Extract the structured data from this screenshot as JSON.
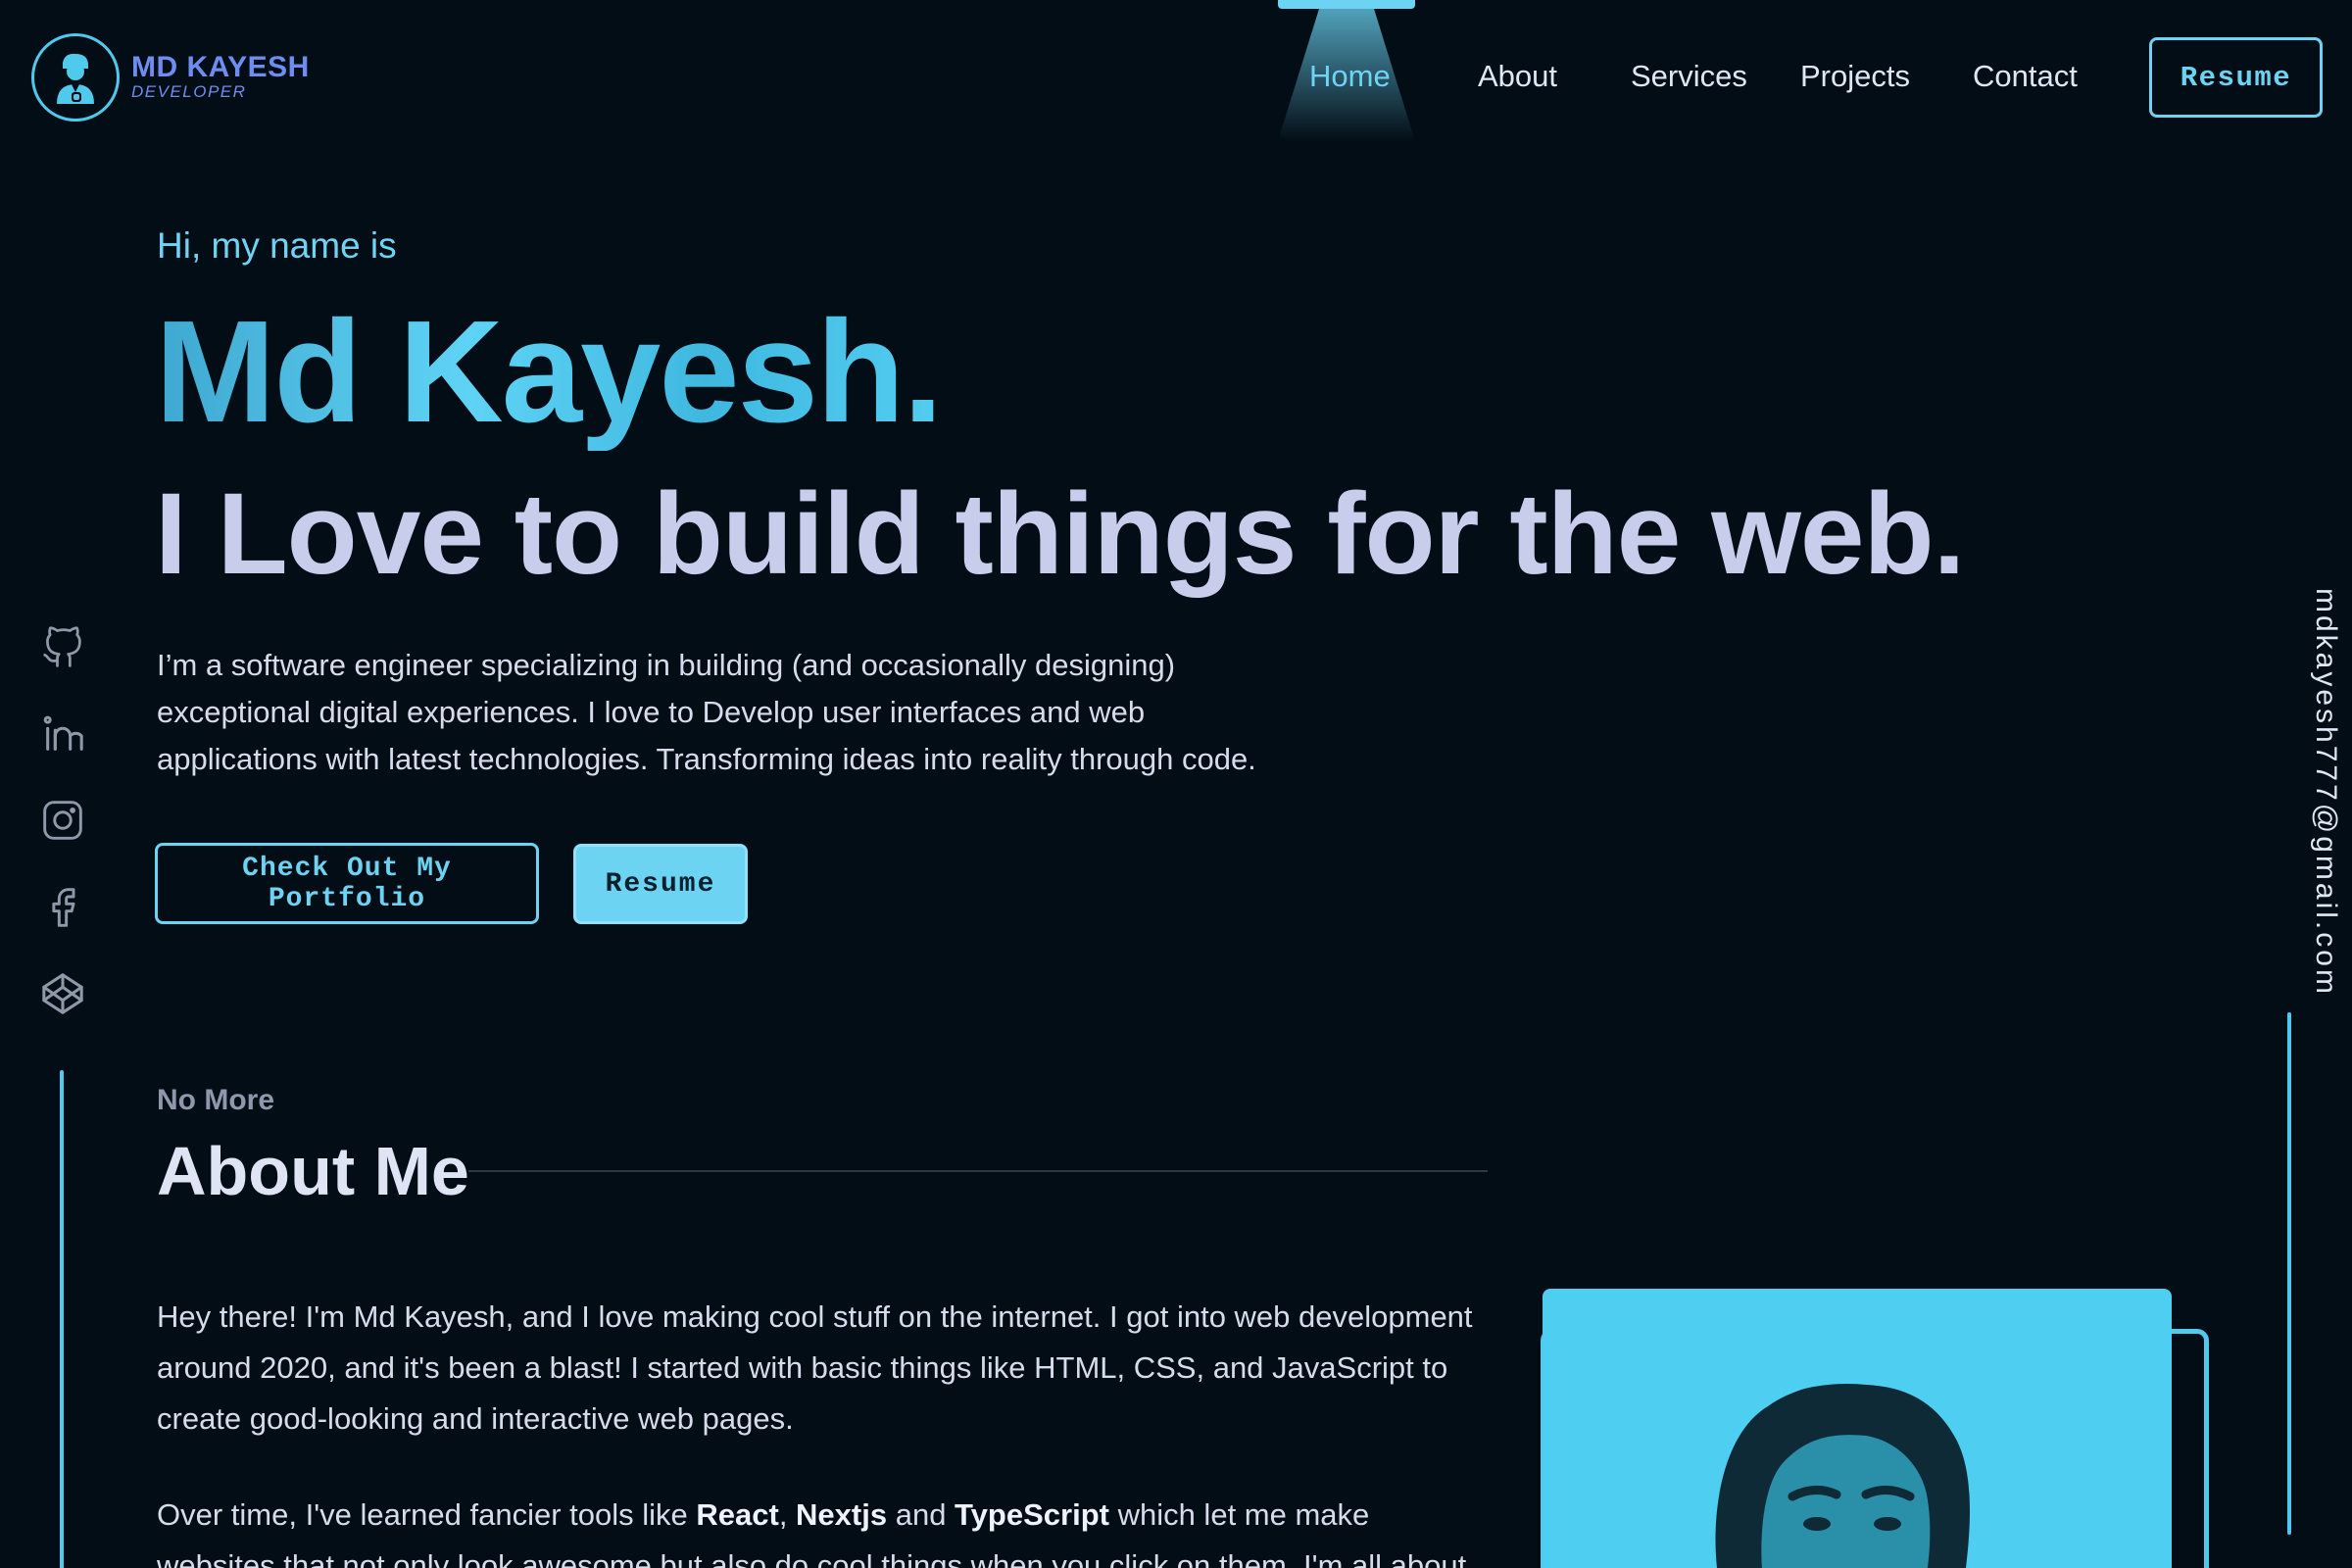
{
  "brand": {
    "name": "MD KAYESH",
    "role": "DEVELOPER"
  },
  "nav": {
    "items": [
      {
        "label": "Home",
        "active": true
      },
      {
        "label": "About",
        "active": false
      },
      {
        "label": "Services",
        "active": false
      },
      {
        "label": "Projects",
        "active": false
      },
      {
        "label": "Contact",
        "active": false
      }
    ],
    "resume_label": "Resume"
  },
  "hero": {
    "greeting": "Hi, my name is",
    "name": "Md Kayesh.",
    "tagline": "I Love to build things for the web.",
    "description": "I’m a software engineer specializing in building (and occasionally designing) exceptional digital experiences. I love to Develop user interfaces and web applications with latest technologies. Transforming ideas into reality through code.",
    "portfolio_button": "Check Out My Portfolio",
    "resume_button": "Resume"
  },
  "social": {
    "icons": [
      "github-icon",
      "linkedin-icon",
      "instagram-icon",
      "facebook-icon",
      "codepen-icon"
    ]
  },
  "email": "mdkayesh777@gmail.com",
  "about": {
    "kicker": "No More",
    "title": "About Me",
    "p1": "Hey there! I'm Md Kayesh, and I love making cool stuff on the internet. I got into web development around 2020, and it's been a blast! I started with basic things like HTML, CSS, and JavaScript to create good-looking and interactive web pages.",
    "p2_before": "Over time, I've learned fancier tools like ",
    "p2_tech1": "React",
    "p2_sep1": ", ",
    "p2_tech2": "Nextjs",
    "p2_sep2": " and ",
    "p2_tech3": "TypeScript",
    "p2_after": " which let me make websites that not only look awesome but also do cool things when you click on them. I'm all about making websites"
  },
  "colors": {
    "background": "#030d15",
    "accent": "#6cd3f3",
    "accent_dark": "#4fc9ec",
    "brand": "#6d8ef0",
    "heading": "#c7cdea",
    "photo_bg": "#4ecff2"
  }
}
